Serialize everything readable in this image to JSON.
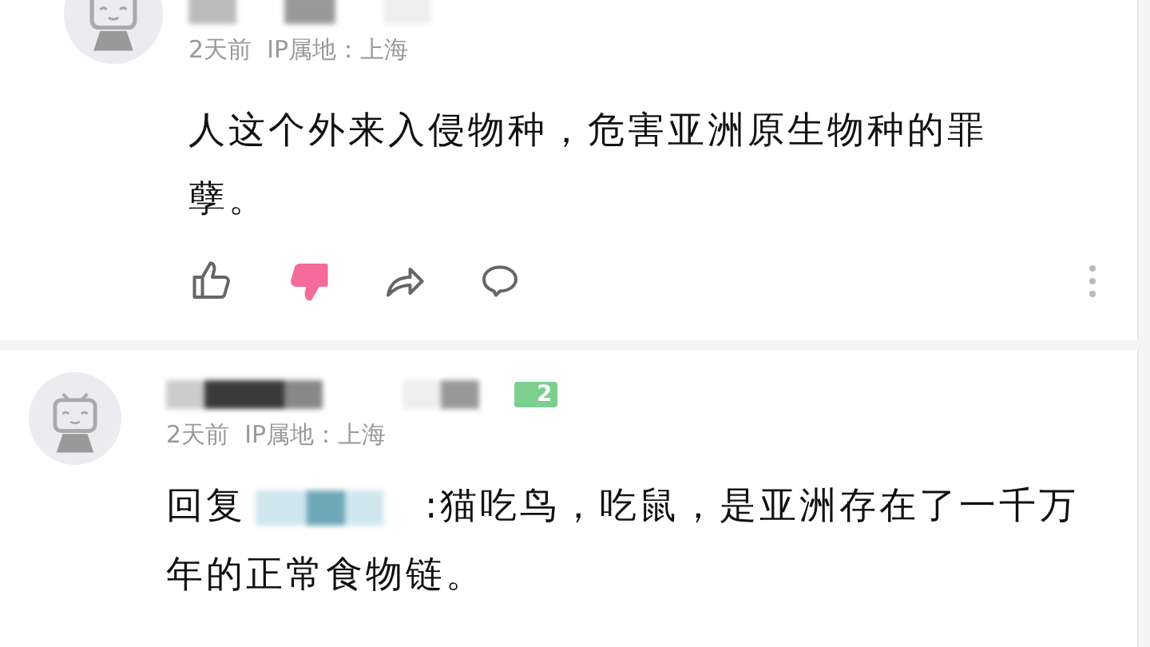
{
  "comments": [
    {
      "meta": "2天前  IP属地：上海",
      "text": "人这个外来入侵物种，危害亚洲原生物种的罪孽。",
      "liked": false,
      "disliked": true
    },
    {
      "rank_badge": "2",
      "meta": "2天前  IP属地：上海",
      "reply_prefix": "回复",
      "text": ":猫吃鸟，吃鼠，是亚洲存在了一千万年的正常食物链。"
    }
  ]
}
